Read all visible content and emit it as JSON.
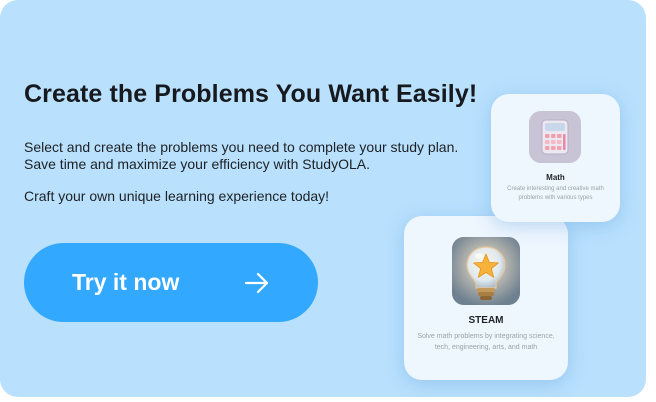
{
  "banner": {
    "headline": "Create the Problems You Want Easily!",
    "description": [
      "Select and create the problems you need to complete your study plan.",
      "Save time and maximize your efficiency with StudyOLA.",
      "Craft your own unique learning experience today!"
    ],
    "cta": {
      "label": "Try it now",
      "icon": "arrow-right-icon"
    }
  },
  "cards": {
    "math": {
      "title": "Math",
      "description": "Create interesting and creative math problems with various types",
      "icon": "calculator-icon"
    },
    "steam": {
      "title": "STEAM",
      "description": "Solve math problems by integrating science, tech, engineering, arts, and math",
      "icon": "lightbulb-star-icon"
    }
  },
  "colors": {
    "banner_background": "#b9e0fd",
    "cta_background": "#33a8ff",
    "card_background": "#eef6fe",
    "headline_text": "#16191d"
  }
}
